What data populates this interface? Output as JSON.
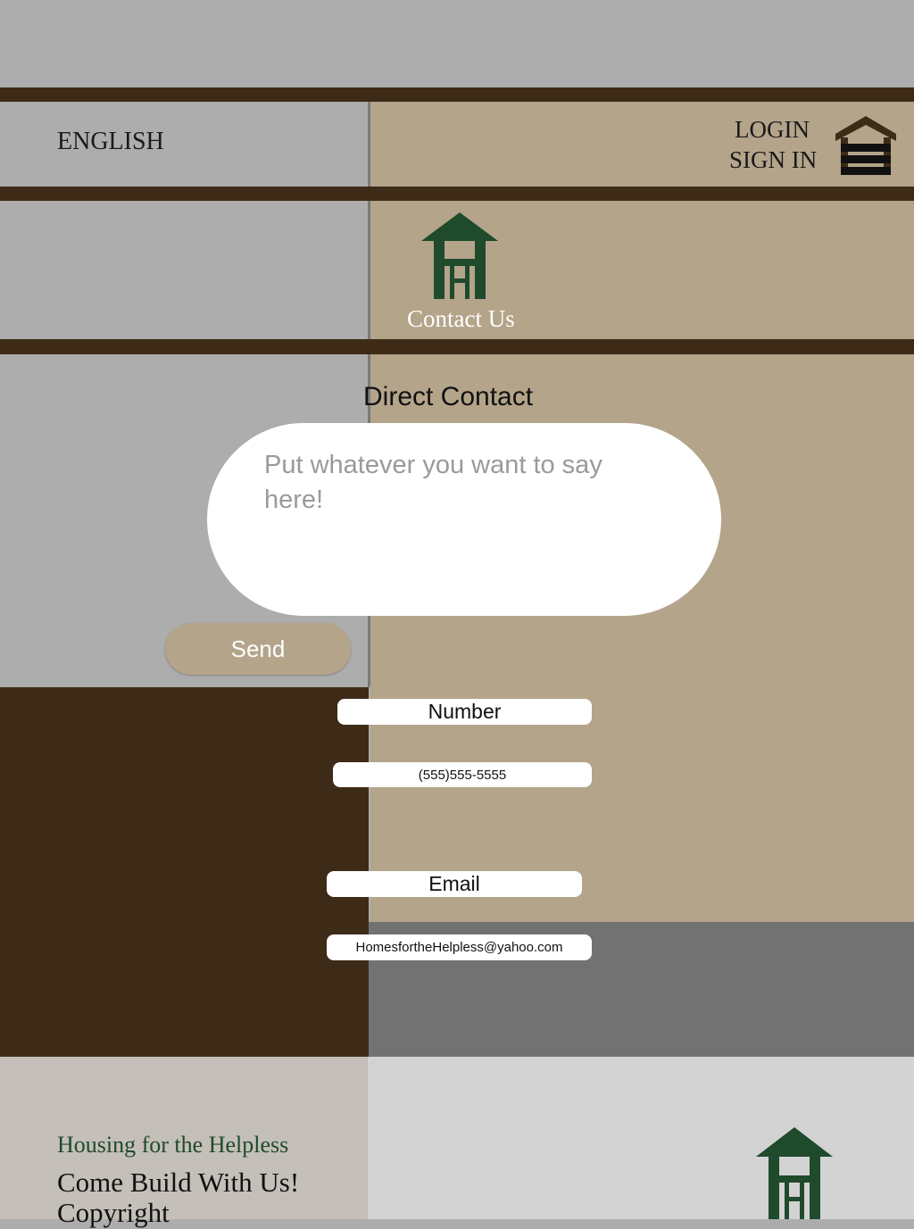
{
  "header": {
    "language_label": "ENGLISH",
    "login_label": "LOGIN",
    "signin_label": "SIGN IN"
  },
  "hero": {
    "title": "Contact Us"
  },
  "contact": {
    "heading": "Direct Contact",
    "message_placeholder": "Put whatever you want to say here!",
    "send_label": "Send",
    "number_label": "Number",
    "number_value": "(555)555-5555",
    "email_label": "Email",
    "email_value": "HomesfortheHelpless@yahoo.com"
  },
  "footer": {
    "org_name": "Housing for the Helpless",
    "tagline": "Come Build With Us!",
    "copyright": "Copyright"
  },
  "colors": {
    "dark_brown": "#3d2b18",
    "tan": "#b4a48a",
    "light_gray": "#adadad",
    "dark_gray": "#727272",
    "green": "#1f4a2c"
  },
  "icons": {
    "header_home": "home-menu-icon",
    "hero_logo": "gazebo-logo-icon",
    "footer_logo": "gazebo-logo-icon"
  }
}
